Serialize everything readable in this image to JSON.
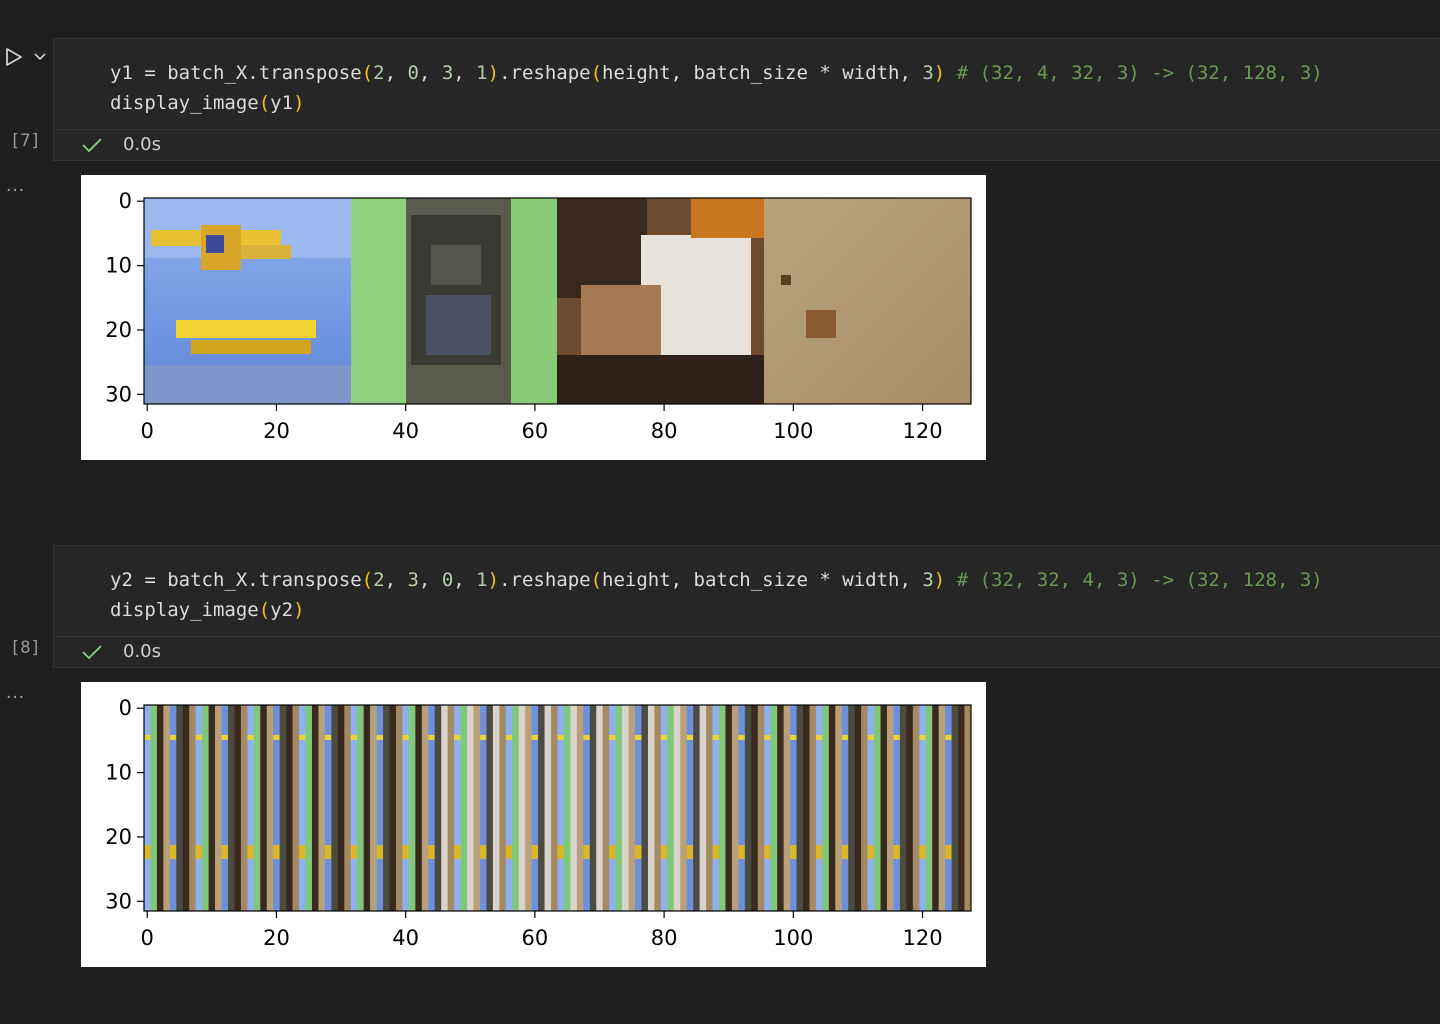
{
  "cells": [
    {
      "exec_count": "[7]",
      "code_lines": [
        {
          "var": "y1",
          "rest": " = batch_X.transpose",
          "args": [
            "2",
            "0",
            "3",
            "1"
          ],
          "mid": ".reshape",
          "args2": "height, batch_size * width, ",
          "num": "3",
          "comment": "# (32, 4, 32, 3) -> (32, 128, 3)"
        },
        {
          "call": "display_image",
          "arg": "y1"
        }
      ],
      "status_time": "0.0s"
    },
    {
      "exec_count": "[8]",
      "code_lines": [
        {
          "var": "y2",
          "rest": " = batch_X.transpose",
          "args": [
            "2",
            "3",
            "0",
            "1"
          ],
          "mid": ".reshape",
          "args2": "height, batch_size * width, ",
          "num": "3",
          "comment": "# (32, 32, 4, 3) -> (32, 128, 3)"
        },
        {
          "call": "display_image",
          "arg": "y2"
        }
      ],
      "status_time": "0.0s"
    }
  ],
  "output_more": "...",
  "plots": [
    {
      "x_ticks": [
        "0",
        "20",
        "40",
        "60",
        "80",
        "100",
        "120"
      ],
      "y_ticks": [
        "0",
        "10",
        "20",
        "30"
      ],
      "image": "four side-by-side CIFAR images (airplane, dog, cat, deer)"
    },
    {
      "x_ticks": [
        "0",
        "20",
        "40",
        "60",
        "80",
        "100",
        "120"
      ],
      "y_ticks": [
        "0",
        "10",
        "20",
        "30"
      ],
      "image": "interleaved vertical pixel stripes"
    }
  ],
  "colors": {
    "background": "#1f1f1f",
    "cell_bg": "#262626",
    "number": "#b5cea8",
    "paren": "#f3c21a",
    "comment": "#6a9955",
    "check": "#89d185"
  }
}
